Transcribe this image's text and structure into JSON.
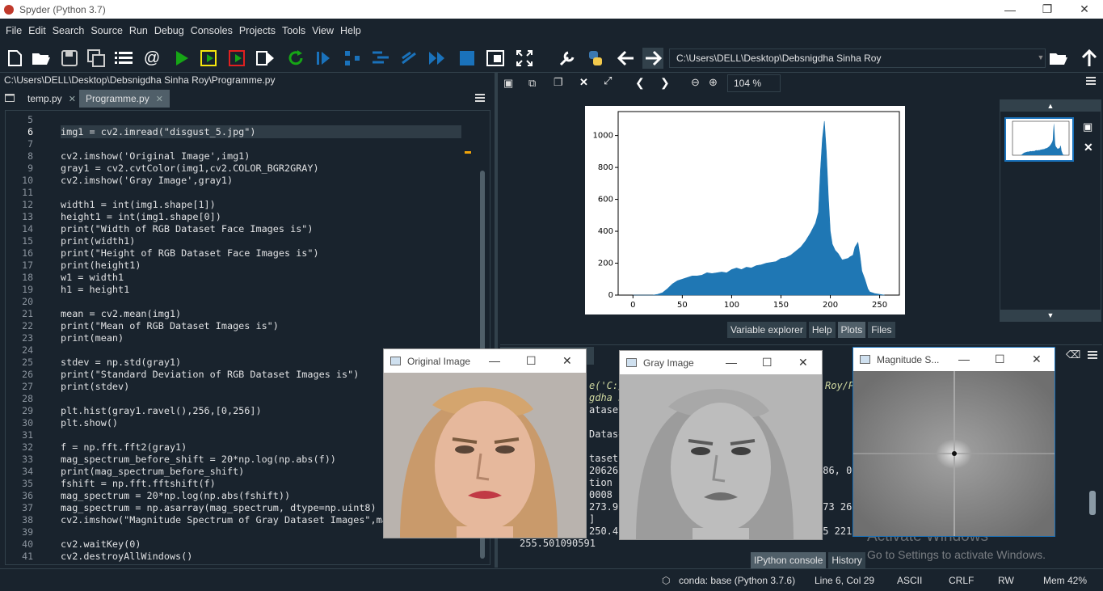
{
  "window": {
    "title": "Spyder (Python 3.7)"
  },
  "menu": [
    "File",
    "Edit",
    "Search",
    "Source",
    "Run",
    "Debug",
    "Consoles",
    "Projects",
    "Tools",
    "View",
    "Help"
  ],
  "toolbar": {
    "path": "C:\\Users\\DELL\\Desktop\\Debsnigdha Sinha Roy"
  },
  "editor": {
    "file_path": "C:\\Users\\DELL\\Desktop\\Debsnigdha Sinha Roy\\Programme.py",
    "tabs": [
      {
        "label": "temp.py"
      },
      {
        "label": "Programme.py"
      }
    ],
    "lines": [
      {
        "n": "5",
        "code": ""
      },
      {
        "n": "6",
        "code": "img1 = cv2.imread(\"disgust_5.jpg\")"
      },
      {
        "n": "7",
        "code": ""
      },
      {
        "n": "8",
        "code": "cv2.imshow('Original Image',img1)"
      },
      {
        "n": "9",
        "code": "gray1 = cv2.cvtColor(img1,cv2.COLOR_BGR2GRAY)"
      },
      {
        "n": "10",
        "code": "cv2.imshow('Gray Image',gray1)"
      },
      {
        "n": "11",
        "code": ""
      },
      {
        "n": "12",
        "code": "width1 = int(img1.shape[1])"
      },
      {
        "n": "13",
        "code": "height1 = int(img1.shape[0])"
      },
      {
        "n": "14",
        "code": "print(\"Width of RGB Dataset Face Images is\")"
      },
      {
        "n": "15",
        "code": "print(width1)"
      },
      {
        "n": "16",
        "code": "print(\"Height of RGB Dataset Face Images is\")"
      },
      {
        "n": "17",
        "code": "print(height1)"
      },
      {
        "n": "18",
        "code": "w1 = width1"
      },
      {
        "n": "19",
        "code": "h1 = height1"
      },
      {
        "n": "20",
        "code": ""
      },
      {
        "n": "21",
        "code": "mean = cv2.mean(img1)"
      },
      {
        "n": "22",
        "code": "print(\"Mean of RGB Dataset Images is\")"
      },
      {
        "n": "23",
        "code": "print(mean)"
      },
      {
        "n": "24",
        "code": ""
      },
      {
        "n": "25",
        "code": "stdev = np.std(gray1)"
      },
      {
        "n": "26",
        "code": "print(\"Standard Deviation of RGB Dataset Images is\")"
      },
      {
        "n": "27",
        "code": "print(stdev)"
      },
      {
        "n": "28",
        "code": ""
      },
      {
        "n": "29",
        "code": "plt.hist(gray1.ravel(),256,[0,256])"
      },
      {
        "n": "30",
        "code": "plt.show()"
      },
      {
        "n": "31",
        "code": ""
      },
      {
        "n": "32",
        "code": "f = np.fft.fft2(gray1)"
      },
      {
        "n": "33",
        "code": "mag_spectrum_before_shift = 20*np.log(np.abs(f))"
      },
      {
        "n": "34",
        "code": "print(mag_spectrum_before_shift)"
      },
      {
        "n": "35",
        "code": "fshift = np.fft.fftshift(f)"
      },
      {
        "n": "36",
        "code": "mag_spectrum = 20*np.log(np.abs(fshift))"
      },
      {
        "n": "37",
        "code": "mag_spectrum = np.asarray(mag_spectrum, dtype=np.uint8)"
      },
      {
        "n": "38",
        "code": "cv2.imshow(\"Magnitude Spectrum of Gray Dataset Images\",ma"
      },
      {
        "n": "39",
        "code": ""
      },
      {
        "n": "40",
        "code": "cv2.waitKey(0)"
      },
      {
        "n": "41",
        "code": "cv2.destroyAllWindows()"
      }
    ]
  },
  "plots": {
    "zoom": "104 %",
    "tabs": [
      "Variable explorer",
      "Help",
      "Plots",
      "Files"
    ],
    "active_tab": "Plots"
  },
  "chart_data": {
    "type": "bar",
    "title": "",
    "xlabel": "",
    "ylabel": "",
    "xlim": [
      -15,
      270
    ],
    "ylim": [
      0,
      1150
    ],
    "xticks": [
      0,
      50,
      100,
      150,
      200,
      250
    ],
    "yticks": [
      0,
      200,
      400,
      600,
      800,
      1000
    ],
    "color": "#1f77b4",
    "series": [
      {
        "x": [
          0,
          10,
          20,
          25,
          30,
          35,
          40,
          45,
          50,
          55,
          60,
          65,
          70,
          75,
          80,
          85,
          90,
          95,
          100,
          105,
          110,
          115,
          120,
          125,
          130,
          135,
          140,
          145,
          150,
          155,
          160,
          165,
          170,
          175,
          180,
          185,
          188,
          190,
          192,
          194,
          196,
          198,
          200,
          202,
          205,
          208,
          210,
          212,
          215,
          218,
          220,
          223,
          225,
          228,
          230,
          232,
          235,
          238,
          240,
          245,
          250,
          255
        ],
        "values": [
          0,
          0,
          0,
          5,
          15,
          40,
          70,
          90,
          100,
          110,
          120,
          120,
          125,
          140,
          135,
          140,
          145,
          140,
          160,
          170,
          160,
          175,
          170,
          185,
          190,
          200,
          205,
          210,
          230,
          235,
          250,
          275,
          300,
          340,
          390,
          450,
          520,
          780,
          980,
          1090,
          900,
          620,
          400,
          320,
          280,
          260,
          240,
          220,
          225,
          230,
          240,
          250,
          300,
          330,
          250,
          150,
          100,
          40,
          20,
          10,
          5,
          0
        ]
      }
    ]
  },
  "cv_windows": {
    "original": {
      "title": "Original Image"
    },
    "gray": {
      "title": "Gray Image"
    },
    "magnitude": {
      "title": "Magnitude S..."
    }
  },
  "console": {
    "tabs": [
      "IPython console",
      "History"
    ],
    "lines": [
      "e('C:/",
      "gdha S",
      "ataset",
      "Datase",
      "taset",
      "20626,",
      "tion c",
      "0008",
      "273.9",
      "]",
      "250.4",
      "255.501090591"
    ],
    "right_fragments": [
      "Roy/P",
      "586, 0",
      "273 266",
      "95 221"
    ]
  },
  "status": {
    "env": "conda: base (Python 3.7.6)",
    "position": "Line 6, Col 29",
    "encoding": "ASCII",
    "eol": "CRLF",
    "permissions": "RW",
    "memory": "Mem 42%"
  },
  "watermark": {
    "line1": "Activate Windows",
    "line2": "Go to Settings to activate Windows."
  }
}
